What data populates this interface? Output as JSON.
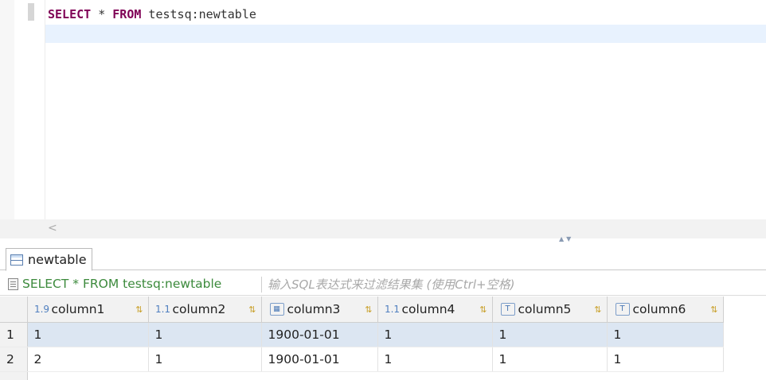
{
  "editor": {
    "kw_select": "SELECT",
    "star": " * ",
    "kw_from": "FROM",
    "table_ref": " testsq:newtable"
  },
  "hscroll": {
    "left_arrow": "<"
  },
  "sash": {
    "arrows": "▲▼"
  },
  "result_tab": {
    "label": "newtable"
  },
  "filter": {
    "query": "SELECT * FROM testsq:newtable",
    "placeholder": "输入SQL表达式来过滤结果集 (使用Ctrl+空格)"
  },
  "grid": {
    "columns": [
      {
        "label": "column1",
        "type_icon": "1.9"
      },
      {
        "label": "column2",
        "type_icon": "1.1"
      },
      {
        "label": "column3",
        "type_icon": "date"
      },
      {
        "label": "column4",
        "type_icon": "1.1"
      },
      {
        "label": "column5",
        "type_icon": "T"
      },
      {
        "label": "column6",
        "type_icon": "T"
      }
    ],
    "rows": [
      {
        "num": "1",
        "cells": [
          "1",
          "1",
          "1900-01-01",
          "1",
          "1",
          "1"
        ]
      },
      {
        "num": "2",
        "cells": [
          "2",
          "1",
          "1900-01-01",
          "1",
          "1",
          "1"
        ]
      }
    ],
    "sort_icon": "⇅"
  }
}
